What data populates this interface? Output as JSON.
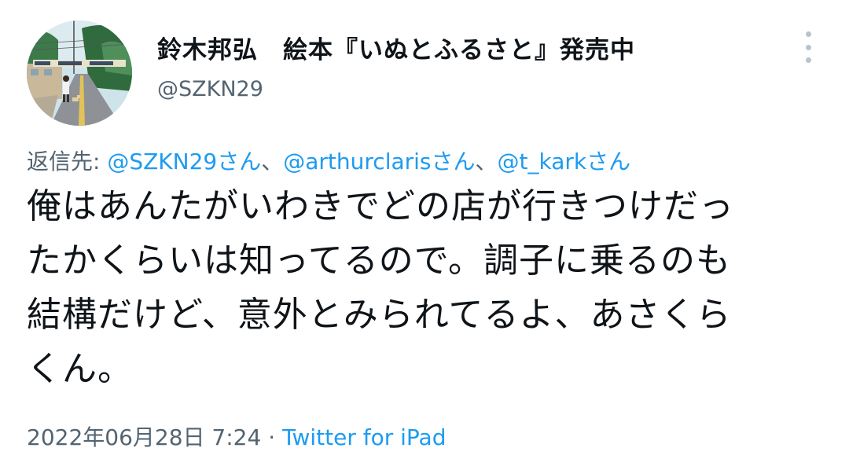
{
  "author": {
    "display_name": "鈴木邦弘　絵本『いぬとふるさと』発売中",
    "handle": "@SZKN29",
    "avatar_icon": "illustrated-street-avatar"
  },
  "reply_to": {
    "prefix": "返信先: ",
    "mentions": [
      "@SZKN29さん",
      "@arthurclarisさん",
      "@t_karkさん"
    ],
    "separator": "、"
  },
  "tweet": {
    "lines": [
      "俺はあんたがいわきでどの店が行きつけだっ",
      "たかくらいは知ってるので。調子に乗るのも",
      "結構だけど、意外とみられてるよ、あさくら",
      "くん。"
    ]
  },
  "meta": {
    "timestamp": "2022年06月28日 7:24",
    "dot": " · ",
    "source": "Twitter for iPad"
  },
  "colors": {
    "text": "#0f1419",
    "secondary": "#536471",
    "link": "#1d9bf0"
  },
  "icons": {
    "more": "more-vertical-icon"
  }
}
